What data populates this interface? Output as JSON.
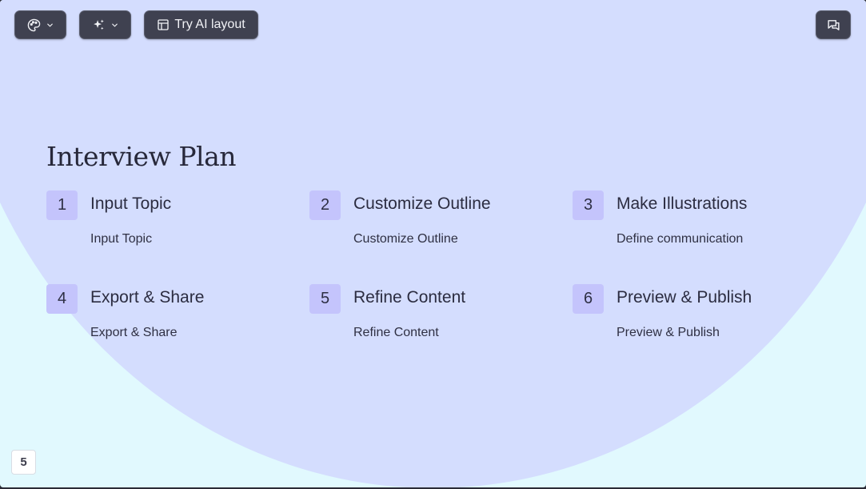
{
  "toolbar": {
    "theme_icon": "palette-icon",
    "ai_icon": "sparkles-icon",
    "ai_layout_icon": "layout-icon",
    "ai_layout_label": "Try AI layout",
    "comments_icon": "comments-icon"
  },
  "slide": {
    "title": "Interview Plan",
    "steps": [
      {
        "number": "1",
        "title": "Input Topic",
        "description": "Input Topic"
      },
      {
        "number": "2",
        "title": "Customize Outline",
        "description": "Customize Outline"
      },
      {
        "number": "3",
        "title": "Make Illustrations",
        "description": "Define communication"
      },
      {
        "number": "4",
        "title": "Export & Share",
        "description": "Export & Share"
      },
      {
        "number": "5",
        "title": "Refine Content",
        "description": "Refine Content"
      },
      {
        "number": "6",
        "title": "Preview & Publish",
        "description": "Preview & Publish"
      }
    ],
    "page_number": "5"
  },
  "colors": {
    "background": "#e1f9fe",
    "blob": "#d4ddfe",
    "number_badge": "#c4c4fc",
    "toolbar_button": "#3f4150",
    "text": "#2b2c40"
  }
}
